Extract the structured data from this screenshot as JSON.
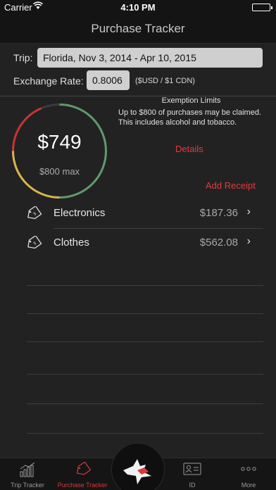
{
  "status_bar": {
    "carrier": "Carrier",
    "time": "4:10 PM"
  },
  "nav": {
    "title": "Purchase Tracker"
  },
  "trip": {
    "label": "Trip:",
    "value": "Florida, Nov 3, 2014 - Apr 10, 2015"
  },
  "exchange": {
    "label": "Exchange Rate:",
    "value": "0.8006",
    "unit": "($USD / $1 CDN)"
  },
  "gauge": {
    "amount": "$749",
    "max": "$800 max",
    "progress": 0.936,
    "colors": {
      "red": "#c8342f",
      "yellow": "#d8b54a",
      "green": "#5f9a6b",
      "track": "#3a3a3a"
    }
  },
  "exemption": {
    "title": "Exemption Limits",
    "text": "Up to $800 of purchases may be claimed. This includes alcohol and tobacco.",
    "details_link": "Details"
  },
  "add_receipt": "Add Receipt",
  "receipts": [
    {
      "name": "Electronics",
      "amount": "$187.36",
      "icon": "price-tag-icon"
    },
    {
      "name": "Clothes",
      "amount": "$562.08",
      "icon": "price-tag-icon"
    }
  ],
  "tabs": [
    {
      "label": "Trip Tracker",
      "icon": "bar-chart-icon",
      "active": false
    },
    {
      "label": "Purchase Tracker",
      "icon": "price-tag-icon",
      "active": true
    },
    {
      "label": "",
      "icon": "maple-leaf-bird-icon",
      "active": false
    },
    {
      "label": "ID",
      "icon": "id-card-icon",
      "active": false
    },
    {
      "label": "More",
      "icon": "more-dots-icon",
      "active": false
    }
  ],
  "accent_color": "#e53a3a"
}
